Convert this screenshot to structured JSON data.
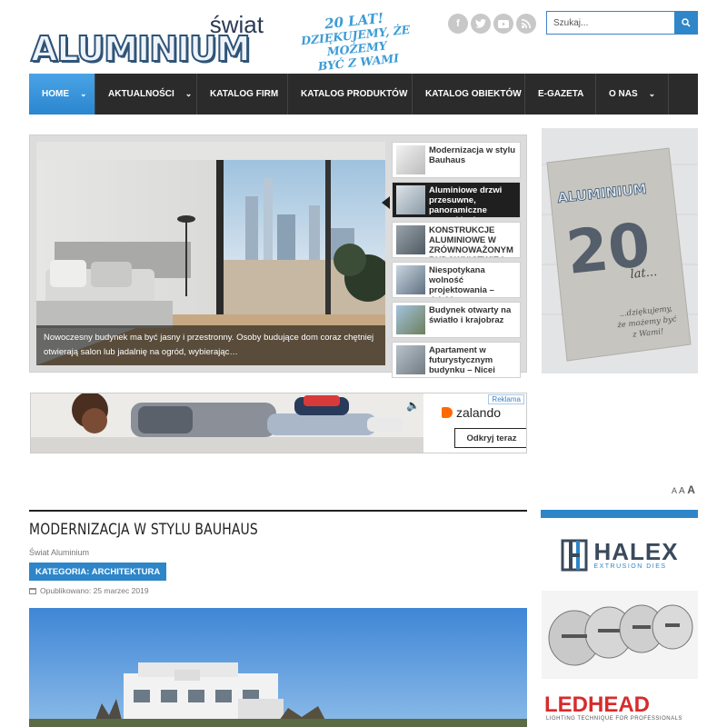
{
  "header": {
    "logo_small": "świat",
    "logo_big": "ALUMINIUM",
    "slogan_line1": "20 LAT!",
    "slogan_line2": "DZIĘKUJEMY, ŻE MOŻEMY",
    "slogan_line3": "BYĆ Z WAMI",
    "social_icons": [
      "facebook-icon",
      "twitter-icon",
      "youtube-icon",
      "rss-icon"
    ],
    "search_placeholder": "Szukaj..."
  },
  "nav": {
    "items": [
      {
        "label": "HOME",
        "has_dropdown": true,
        "active": true
      },
      {
        "label": "AKTUALNOŚCI",
        "has_dropdown": true
      },
      {
        "label": "KATALOG FIRM",
        "has_dropdown": false
      },
      {
        "label": "KATALOG PRODUKTÓW",
        "has_dropdown": false
      },
      {
        "label": "KATALOG OBIEKTÓW",
        "has_dropdown": false
      },
      {
        "label": "E-GAZETA",
        "has_dropdown": false
      },
      {
        "label": "O NAS",
        "has_dropdown": true
      }
    ]
  },
  "slider": {
    "caption": "Nowoczesny budynek ma być jasny i przestronny. Osoby budujące dom coraz chętniej otwierają salon lub jadalnię na ogród, wybierając…",
    "thumbs": [
      {
        "title": "Modernizacja w stylu Bauhaus"
      },
      {
        "title": "Aluminiowe drzwi przesuwne, panoramiczne przeszklenia",
        "active": true
      },
      {
        "title": "KONSTRUKCJE ALUMINIOWE W ZRÓWNOWAŻONYM BUDOWNICTWIE I"
      },
      {
        "title": "Niespotykana wolność projektowania – dzięki nowemu"
      },
      {
        "title": "Budynek otwarty na światło i krajobraz"
      },
      {
        "title": "Apartament w futurystycznym budynku – Nicei"
      }
    ]
  },
  "magazine": {
    "title": "ALUMINIUM",
    "number": "20",
    "lat": "lat...",
    "thanks": "...dziękujemy, że możemy być z Wami!"
  },
  "ad": {
    "badge": "Reklama",
    "brand": "zalando",
    "cta": "Odkryj teraz"
  },
  "font_controls": [
    "A",
    "A",
    "A"
  ],
  "article": {
    "title": "MODERNIZACJA W STYLU BAUHAUS",
    "author": "Świat Aluminium",
    "category": "KATEGORIA: ARCHITEKTURA",
    "published": "Opublikowano: 25 marzec 2019"
  },
  "sidebar_ads": {
    "halex_name": "HALEX",
    "halex_sub": "EXTRUSION DIES",
    "ledhead_name": "LEDHEAD",
    "ledhead_sub": "LIGHTING TECHNIQUE FOR PROFESSIONALS"
  },
  "colors": {
    "accent": "#2e86c9",
    "nav_bg": "#2b2b2b",
    "zalando": "#ff6900",
    "ledhead": "#d62c2c"
  }
}
